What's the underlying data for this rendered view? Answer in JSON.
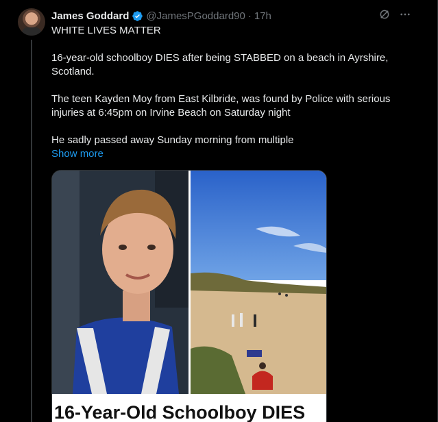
{
  "author": {
    "display_name": "James Goddard",
    "handle": "@JamesPGoddard90",
    "separator": "·",
    "time": "17h",
    "verified": true,
    "avatar_icon": "user-avatar"
  },
  "icons": {
    "grok": "grok-icon",
    "more": "more-icon",
    "verified": "verified-badge-icon"
  },
  "tweet": {
    "paragraphs": [
      "WHITE LIVES MATTER",
      "16-year-old schoolboy DIES after being STABBED on a beach in Ayrshire, Scotland.",
      "The teen Kayden Moy from East Kilbride, was found by Police with serious injuries at 6:45pm on Irvine Beach on Saturday night",
      "He sadly passed away Sunday morning from multiple"
    ],
    "show_more": "Show more"
  },
  "media": {
    "caption": "16-Year-Old Schoolboy DIES"
  },
  "colors": {
    "background": "#000000",
    "text": "#e7e9ea",
    "muted": "#71767b",
    "link": "#1d9bf0",
    "verified": "#1d9bf0"
  }
}
